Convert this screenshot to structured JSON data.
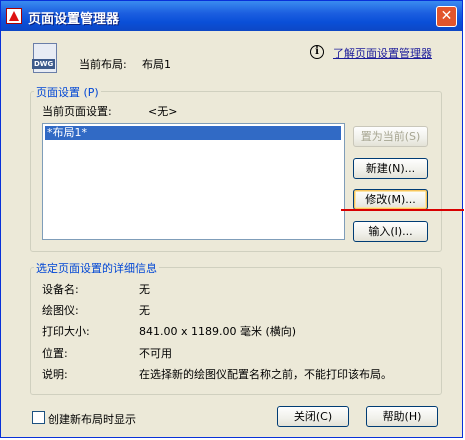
{
  "window": {
    "title": "页面设置管理器",
    "close_glyph": "✕"
  },
  "header": {
    "icon_tag": "DWG",
    "current_layout_label": "当前布局:",
    "current_layout_value": "布局1",
    "info_glyph": "i",
    "help_link": "了解页面设置管理器"
  },
  "page_setup": {
    "group_title": "页面设置 (P)",
    "current_label": "当前页面设置:",
    "current_value": "<无>",
    "list_items": [
      "*布局1*"
    ],
    "buttons": {
      "set_current": "置为当前(S)",
      "new": "新建(N)...",
      "modify": "修改(M)...",
      "import": "输入(I)..."
    }
  },
  "details": {
    "group_title": "选定页面设置的详细信息",
    "rows": [
      {
        "label": "设备名:",
        "value": "无"
      },
      {
        "label": "绘图仪:",
        "value": "无"
      },
      {
        "label": "打印大小:",
        "value": "841.00 x 1189.00 毫米 (横向)"
      },
      {
        "label": "位置:",
        "value": "不可用"
      },
      {
        "label": "说明:",
        "value": "在选择新的绘图仪配置名称之前，不能打印该布局。"
      }
    ]
  },
  "footer": {
    "checkbox_label": "创建新布局时显示",
    "checkbox_checked": false,
    "close_button": "关闭(C)",
    "help_button": "帮助(H)"
  },
  "colors": {
    "title_bar": "#0a4fd8",
    "group_title": "#0046d5",
    "selection": "#316ac5",
    "annotation_line": "#d80000"
  }
}
